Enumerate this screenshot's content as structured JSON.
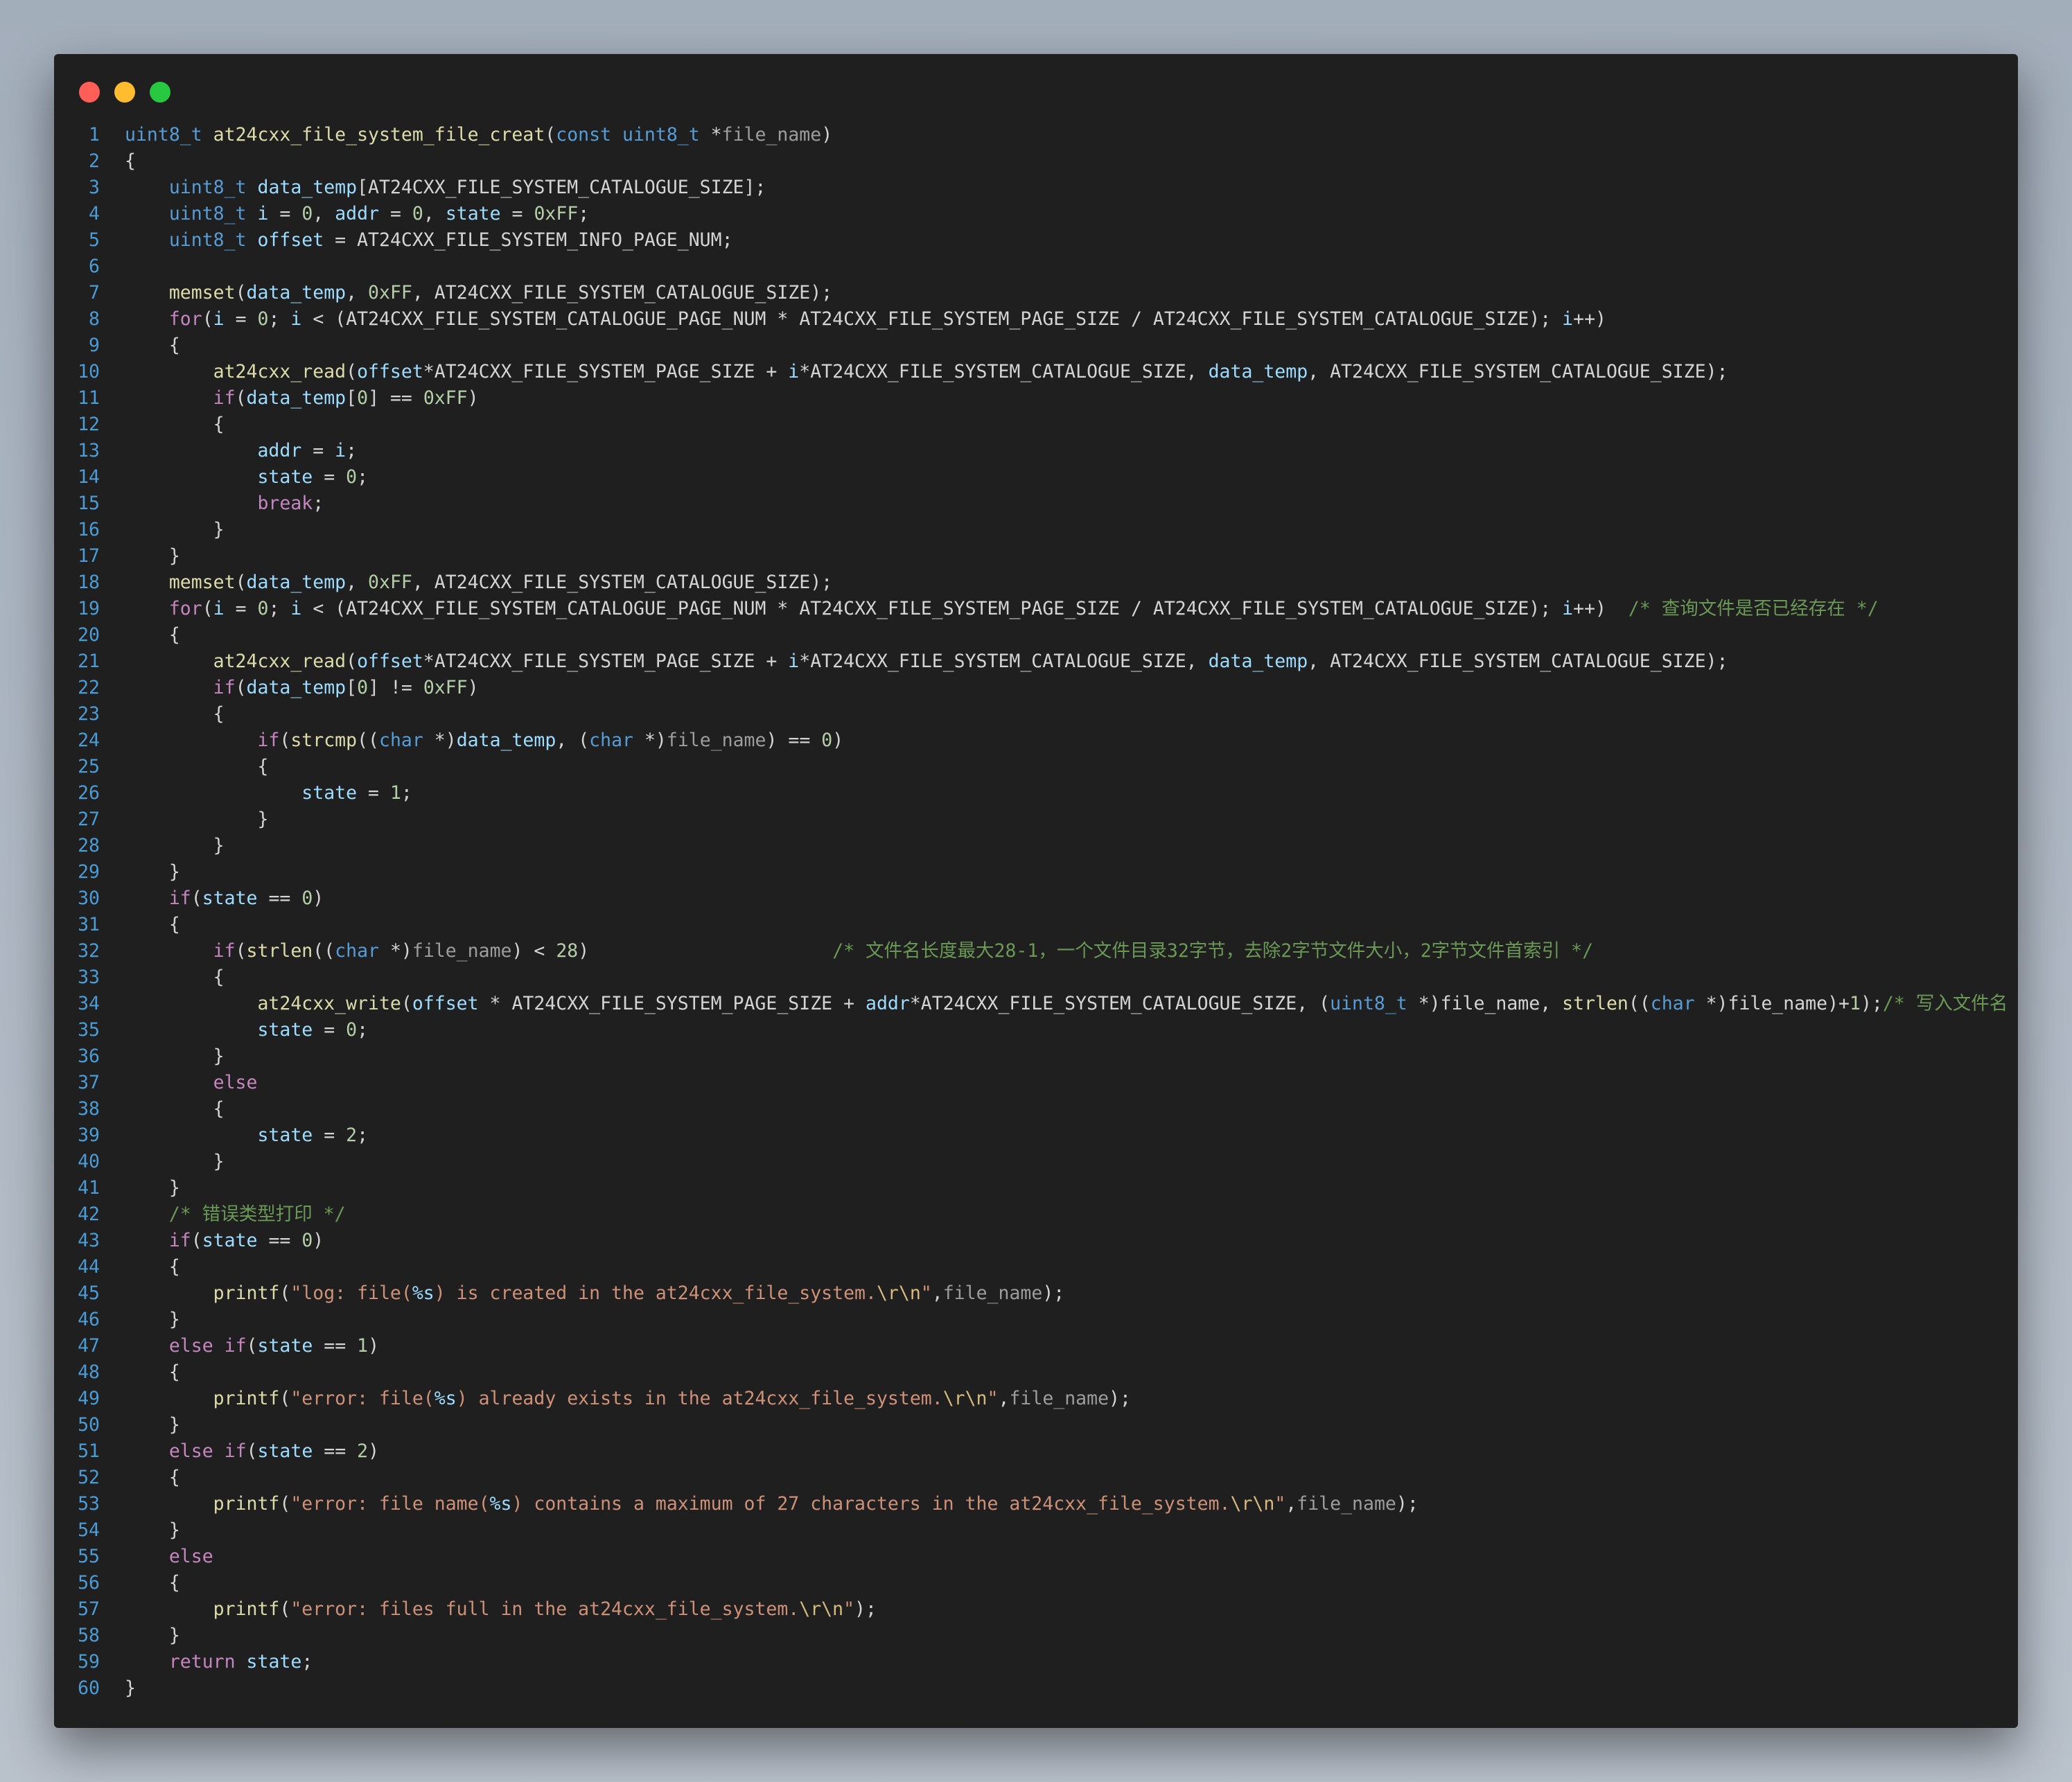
{
  "window": {
    "controls": {
      "close_color": "#ff5f57",
      "minimize_color": "#febc2e",
      "maximize_color": "#28c840"
    }
  },
  "code_lines": [
    [
      {
        "t": "uint8_t",
        "c": "ty"
      },
      {
        "t": " "
      },
      {
        "t": "at24cxx_file_system_file_creat",
        "c": "fn"
      },
      {
        "t": "("
      },
      {
        "t": "const",
        "c": "ty"
      },
      {
        "t": " "
      },
      {
        "t": "uint8_t",
        "c": "ty"
      },
      {
        "t": " *"
      },
      {
        "t": "file_name",
        "c": "prm"
      },
      {
        "t": ")"
      }
    ],
    [
      {
        "t": "{"
      }
    ],
    [
      {
        "t": "    "
      },
      {
        "t": "uint8_t",
        "c": "ty"
      },
      {
        "t": " "
      },
      {
        "t": "data_temp",
        "c": "var"
      },
      {
        "t": "[AT24CXX_FILE_SYSTEM_CATALOGUE_SIZE];"
      }
    ],
    [
      {
        "t": "    "
      },
      {
        "t": "uint8_t",
        "c": "ty"
      },
      {
        "t": " "
      },
      {
        "t": "i",
        "c": "var"
      },
      {
        "t": " = "
      },
      {
        "t": "0",
        "c": "num"
      },
      {
        "t": ", "
      },
      {
        "t": "addr",
        "c": "var"
      },
      {
        "t": " = "
      },
      {
        "t": "0",
        "c": "num"
      },
      {
        "t": ", "
      },
      {
        "t": "state",
        "c": "var"
      },
      {
        "t": " = "
      },
      {
        "t": "0xFF",
        "c": "num"
      },
      {
        "t": ";"
      }
    ],
    [
      {
        "t": "    "
      },
      {
        "t": "uint8_t",
        "c": "ty"
      },
      {
        "t": " "
      },
      {
        "t": "offset",
        "c": "var"
      },
      {
        "t": " = AT24CXX_FILE_SYSTEM_INFO_PAGE_NUM;"
      }
    ],
    [],
    [
      {
        "t": "    "
      },
      {
        "t": "memset",
        "c": "fn"
      },
      {
        "t": "("
      },
      {
        "t": "data_temp",
        "c": "var"
      },
      {
        "t": ", "
      },
      {
        "t": "0xFF",
        "c": "num"
      },
      {
        "t": ", AT24CXX_FILE_SYSTEM_CATALOGUE_SIZE);"
      }
    ],
    [
      {
        "t": "    "
      },
      {
        "t": "for",
        "c": "kw"
      },
      {
        "t": "("
      },
      {
        "t": "i",
        "c": "var"
      },
      {
        "t": " = "
      },
      {
        "t": "0",
        "c": "num"
      },
      {
        "t": "; "
      },
      {
        "t": "i",
        "c": "var"
      },
      {
        "t": " < (AT24CXX_FILE_SYSTEM_CATALOGUE_PAGE_NUM * AT24CXX_FILE_SYSTEM_PAGE_SIZE / AT24CXX_FILE_SYSTEM_CATALOGUE_SIZE); "
      },
      {
        "t": "i",
        "c": "var"
      },
      {
        "t": "++)"
      }
    ],
    [
      {
        "t": "    {"
      }
    ],
    [
      {
        "t": "        "
      },
      {
        "t": "at24cxx_read",
        "c": "fn"
      },
      {
        "t": "("
      },
      {
        "t": "offset",
        "c": "var"
      },
      {
        "t": "*AT24CXX_FILE_SYSTEM_PAGE_SIZE + "
      },
      {
        "t": "i",
        "c": "var"
      },
      {
        "t": "*AT24CXX_FILE_SYSTEM_CATALOGUE_SIZE, "
      },
      {
        "t": "data_temp",
        "c": "var"
      },
      {
        "t": ", AT24CXX_FILE_SYSTEM_CATALOGUE_SIZE);"
      }
    ],
    [
      {
        "t": "        "
      },
      {
        "t": "if",
        "c": "kw"
      },
      {
        "t": "("
      },
      {
        "t": "data_temp",
        "c": "var"
      },
      {
        "t": "["
      },
      {
        "t": "0",
        "c": "num"
      },
      {
        "t": "] == "
      },
      {
        "t": "0xFF",
        "c": "num"
      },
      {
        "t": ")"
      }
    ],
    [
      {
        "t": "        {"
      }
    ],
    [
      {
        "t": "            "
      },
      {
        "t": "addr",
        "c": "var"
      },
      {
        "t": " = "
      },
      {
        "t": "i",
        "c": "var"
      },
      {
        "t": ";"
      }
    ],
    [
      {
        "t": "            "
      },
      {
        "t": "state",
        "c": "var"
      },
      {
        "t": " = "
      },
      {
        "t": "0",
        "c": "num"
      },
      {
        "t": ";"
      }
    ],
    [
      {
        "t": "            "
      },
      {
        "t": "break",
        "c": "kw"
      },
      {
        "t": ";"
      }
    ],
    [
      {
        "t": "        }"
      }
    ],
    [
      {
        "t": "    }"
      }
    ],
    [
      {
        "t": "    "
      },
      {
        "t": "memset",
        "c": "fn"
      },
      {
        "t": "("
      },
      {
        "t": "data_temp",
        "c": "var"
      },
      {
        "t": ", "
      },
      {
        "t": "0xFF",
        "c": "num"
      },
      {
        "t": ", AT24CXX_FILE_SYSTEM_CATALOGUE_SIZE);"
      }
    ],
    [
      {
        "t": "    "
      },
      {
        "t": "for",
        "c": "kw"
      },
      {
        "t": "("
      },
      {
        "t": "i",
        "c": "var"
      },
      {
        "t": " = "
      },
      {
        "t": "0",
        "c": "num"
      },
      {
        "t": "; "
      },
      {
        "t": "i",
        "c": "var"
      },
      {
        "t": " < (AT24CXX_FILE_SYSTEM_CATALOGUE_PAGE_NUM * AT24CXX_FILE_SYSTEM_PAGE_SIZE / AT24CXX_FILE_SYSTEM_CATALOGUE_SIZE); "
      },
      {
        "t": "i",
        "c": "var"
      },
      {
        "t": "++)  "
      },
      {
        "t": "/* 查询文件是否已经存在 */",
        "c": "cm"
      }
    ],
    [
      {
        "t": "    {"
      }
    ],
    [
      {
        "t": "        "
      },
      {
        "t": "at24cxx_read",
        "c": "fn"
      },
      {
        "t": "("
      },
      {
        "t": "offset",
        "c": "var"
      },
      {
        "t": "*AT24CXX_FILE_SYSTEM_PAGE_SIZE + "
      },
      {
        "t": "i",
        "c": "var"
      },
      {
        "t": "*AT24CXX_FILE_SYSTEM_CATALOGUE_SIZE, "
      },
      {
        "t": "data_temp",
        "c": "var"
      },
      {
        "t": ", AT24CXX_FILE_SYSTEM_CATALOGUE_SIZE);"
      }
    ],
    [
      {
        "t": "        "
      },
      {
        "t": "if",
        "c": "kw"
      },
      {
        "t": "("
      },
      {
        "t": "data_temp",
        "c": "var"
      },
      {
        "t": "["
      },
      {
        "t": "0",
        "c": "num"
      },
      {
        "t": "] != "
      },
      {
        "t": "0xFF",
        "c": "num"
      },
      {
        "t": ")"
      }
    ],
    [
      {
        "t": "        {"
      }
    ],
    [
      {
        "t": "            "
      },
      {
        "t": "if",
        "c": "kw"
      },
      {
        "t": "("
      },
      {
        "t": "strcmp",
        "c": "fn"
      },
      {
        "t": "(("
      },
      {
        "t": "char",
        "c": "ty"
      },
      {
        "t": " *)"
      },
      {
        "t": "data_temp",
        "c": "var"
      },
      {
        "t": ", ("
      },
      {
        "t": "char",
        "c": "ty"
      },
      {
        "t": " *)"
      },
      {
        "t": "file_name",
        "c": "prm"
      },
      {
        "t": ") == "
      },
      {
        "t": "0",
        "c": "num"
      },
      {
        "t": ")"
      }
    ],
    [
      {
        "t": "            {"
      }
    ],
    [
      {
        "t": "                "
      },
      {
        "t": "state",
        "c": "var"
      },
      {
        "t": " = "
      },
      {
        "t": "1",
        "c": "num"
      },
      {
        "t": ";"
      }
    ],
    [
      {
        "t": "            }"
      }
    ],
    [
      {
        "t": "        }"
      }
    ],
    [
      {
        "t": "    }"
      }
    ],
    [
      {
        "t": "    "
      },
      {
        "t": "if",
        "c": "kw"
      },
      {
        "t": "("
      },
      {
        "t": "state",
        "c": "var"
      },
      {
        "t": " == "
      },
      {
        "t": "0",
        "c": "num"
      },
      {
        "t": ")"
      }
    ],
    [
      {
        "t": "    {"
      }
    ],
    [
      {
        "t": "        "
      },
      {
        "t": "if",
        "c": "kw"
      },
      {
        "t": "("
      },
      {
        "t": "strlen",
        "c": "fn"
      },
      {
        "t": "(("
      },
      {
        "t": "char",
        "c": "ty"
      },
      {
        "t": " *)"
      },
      {
        "t": "file_name",
        "c": "prm"
      },
      {
        "t": ") < "
      },
      {
        "t": "28",
        "c": "num"
      },
      {
        "t": ")                      "
      },
      {
        "t": "/* 文件名长度最大28-1，一个文件目录32字节，去除2字节文件大小，2字节文件首索引 */",
        "c": "cm"
      }
    ],
    [
      {
        "t": "        {"
      }
    ],
    [
      {
        "t": "            "
      },
      {
        "t": "at24cxx_write",
        "c": "fn"
      },
      {
        "t": "("
      },
      {
        "t": "offset",
        "c": "var"
      },
      {
        "t": " * AT24CXX_FILE_SYSTEM_PAGE_SIZE + "
      },
      {
        "t": "addr",
        "c": "var"
      },
      {
        "t": "*AT24CXX_FILE_SYSTEM_CATALOGUE_SIZE, ("
      },
      {
        "t": "uint8_t",
        "c": "ty"
      },
      {
        "t": " *)file_name, "
      },
      {
        "t": "strlen",
        "c": "fn"
      },
      {
        "t": "(("
      },
      {
        "t": "char",
        "c": "ty"
      },
      {
        "t": " *)file_name)+"
      },
      {
        "t": "1",
        "c": "num"
      },
      {
        "t": ");"
      },
      {
        "t": "/* 写入文件名 */",
        "c": "cm"
      }
    ],
    [
      {
        "t": "            "
      },
      {
        "t": "state",
        "c": "var"
      },
      {
        "t": " = "
      },
      {
        "t": "0",
        "c": "num"
      },
      {
        "t": ";"
      }
    ],
    [
      {
        "t": "        }"
      }
    ],
    [
      {
        "t": "        "
      },
      {
        "t": "else",
        "c": "kw"
      }
    ],
    [
      {
        "t": "        {"
      }
    ],
    [
      {
        "t": "            "
      },
      {
        "t": "state",
        "c": "var"
      },
      {
        "t": " = "
      },
      {
        "t": "2",
        "c": "num"
      },
      {
        "t": ";"
      }
    ],
    [
      {
        "t": "        }"
      }
    ],
    [
      {
        "t": "    }"
      }
    ],
    [
      {
        "t": "    "
      },
      {
        "t": "/* 错误类型打印 */",
        "c": "cm"
      }
    ],
    [
      {
        "t": "    "
      },
      {
        "t": "if",
        "c": "kw"
      },
      {
        "t": "("
      },
      {
        "t": "state",
        "c": "var"
      },
      {
        "t": " == "
      },
      {
        "t": "0",
        "c": "num"
      },
      {
        "t": ")"
      }
    ],
    [
      {
        "t": "    {"
      }
    ],
    [
      {
        "t": "        "
      },
      {
        "t": "printf",
        "c": "fn"
      },
      {
        "t": "("
      },
      {
        "t": "\"log: file(",
        "c": "str"
      },
      {
        "t": "%s",
        "c": "var"
      },
      {
        "t": ") is created in the at24cxx_file_system.",
        "c": "str"
      },
      {
        "t": "\\r\\n",
        "c": "esc"
      },
      {
        "t": "\"",
        "c": "str"
      },
      {
        "t": ","
      },
      {
        "t": "file_name",
        "c": "prm"
      },
      {
        "t": ");"
      }
    ],
    [
      {
        "t": "    }"
      }
    ],
    [
      {
        "t": "    "
      },
      {
        "t": "else",
        "c": "kw"
      },
      {
        "t": " "
      },
      {
        "t": "if",
        "c": "kw"
      },
      {
        "t": "("
      },
      {
        "t": "state",
        "c": "var"
      },
      {
        "t": " == "
      },
      {
        "t": "1",
        "c": "num"
      },
      {
        "t": ")"
      }
    ],
    [
      {
        "t": "    {"
      }
    ],
    [
      {
        "t": "        "
      },
      {
        "t": "printf",
        "c": "fn"
      },
      {
        "t": "("
      },
      {
        "t": "\"error: file(",
        "c": "str"
      },
      {
        "t": "%s",
        "c": "var"
      },
      {
        "t": ") already exists in the at24cxx_file_system.",
        "c": "str"
      },
      {
        "t": "\\r\\n",
        "c": "esc"
      },
      {
        "t": "\"",
        "c": "str"
      },
      {
        "t": ","
      },
      {
        "t": "file_name",
        "c": "prm"
      },
      {
        "t": ");"
      }
    ],
    [
      {
        "t": "    }"
      }
    ],
    [
      {
        "t": "    "
      },
      {
        "t": "else",
        "c": "kw"
      },
      {
        "t": " "
      },
      {
        "t": "if",
        "c": "kw"
      },
      {
        "t": "("
      },
      {
        "t": "state",
        "c": "var"
      },
      {
        "t": " == "
      },
      {
        "t": "2",
        "c": "num"
      },
      {
        "t": ")"
      }
    ],
    [
      {
        "t": "    {"
      }
    ],
    [
      {
        "t": "        "
      },
      {
        "t": "printf",
        "c": "fn"
      },
      {
        "t": "("
      },
      {
        "t": "\"error: file name(",
        "c": "str"
      },
      {
        "t": "%s",
        "c": "var"
      },
      {
        "t": ") contains a maximum of 27 characters in the at24cxx_file_system.",
        "c": "str"
      },
      {
        "t": "\\r\\n",
        "c": "esc"
      },
      {
        "t": "\"",
        "c": "str"
      },
      {
        "t": ","
      },
      {
        "t": "file_name",
        "c": "prm"
      },
      {
        "t": ");"
      }
    ],
    [
      {
        "t": "    }"
      }
    ],
    [
      {
        "t": "    "
      },
      {
        "t": "else",
        "c": "kw"
      }
    ],
    [
      {
        "t": "    {"
      }
    ],
    [
      {
        "t": "        "
      },
      {
        "t": "printf",
        "c": "fn"
      },
      {
        "t": "("
      },
      {
        "t": "\"error: files full in the at24cxx_file_system.",
        "c": "str"
      },
      {
        "t": "\\r\\n",
        "c": "esc"
      },
      {
        "t": "\"",
        "c": "str"
      },
      {
        "t": ");"
      }
    ],
    [
      {
        "t": "    }"
      }
    ],
    [
      {
        "t": "    "
      },
      {
        "t": "return",
        "c": "kw"
      },
      {
        "t": " "
      },
      {
        "t": "state",
        "c": "var"
      },
      {
        "t": ";"
      }
    ],
    [
      {
        "t": "}"
      }
    ]
  ]
}
